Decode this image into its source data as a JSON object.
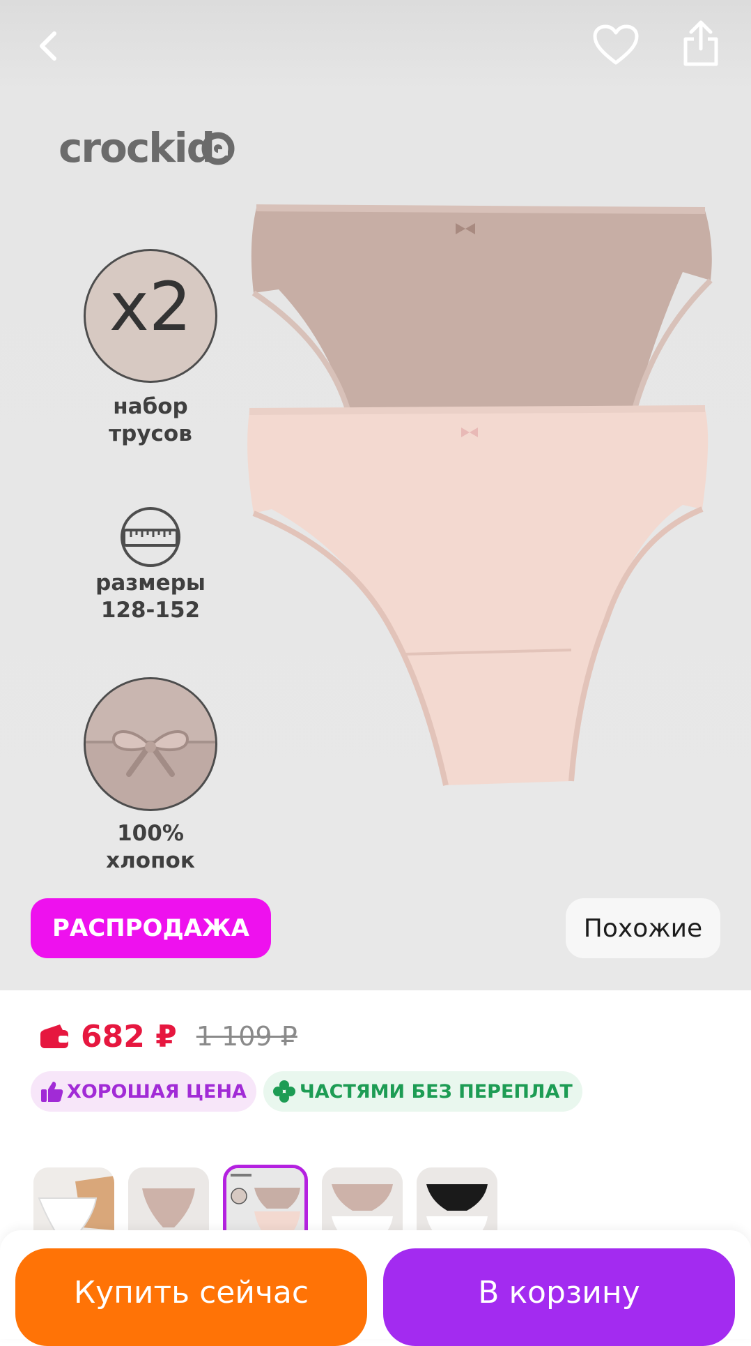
{
  "hero": {
    "brand_logo_text": "crockid",
    "features": [
      {
        "badge": "x2",
        "label_line1": "набор",
        "label_line2": "трусов"
      },
      {
        "icon": "ruler-icon",
        "label_line1": "размеры",
        "label_line2": "128-152"
      },
      {
        "icon": "bow-detail",
        "label_line1": "100%",
        "label_line2": "хлопок"
      }
    ],
    "sale_badge": "РАСПРОДАЖА",
    "similar_button": "Похожие"
  },
  "toolbar": {
    "back_icon": "chevron-left-icon",
    "favorite_icon": "heart-icon",
    "share_icon": "share-icon"
  },
  "pricing": {
    "price": "682 ₽",
    "old_price": "1 109 ₽",
    "wallet_icon": "wallet-icon"
  },
  "chips": [
    {
      "label": "ХОРОШАЯ ЦЕНА",
      "icon": "thumbs-up-icon"
    },
    {
      "label": "ЧАСТЯМИ БЕЗ ПЕРЕПЛАТ",
      "icon": "clover-icon"
    }
  ],
  "colors": {
    "sale": "#ee11ee",
    "price": "#e6173f",
    "buy": "#ff7306",
    "cart": "#a32bf0",
    "good_price": "#a12bd6",
    "installments": "#1d9c54"
  },
  "variants": {
    "selected_index": 2,
    "count": 5
  },
  "actions": {
    "buy_now": "Купить сейчас",
    "add_to_cart": "В корзину"
  }
}
